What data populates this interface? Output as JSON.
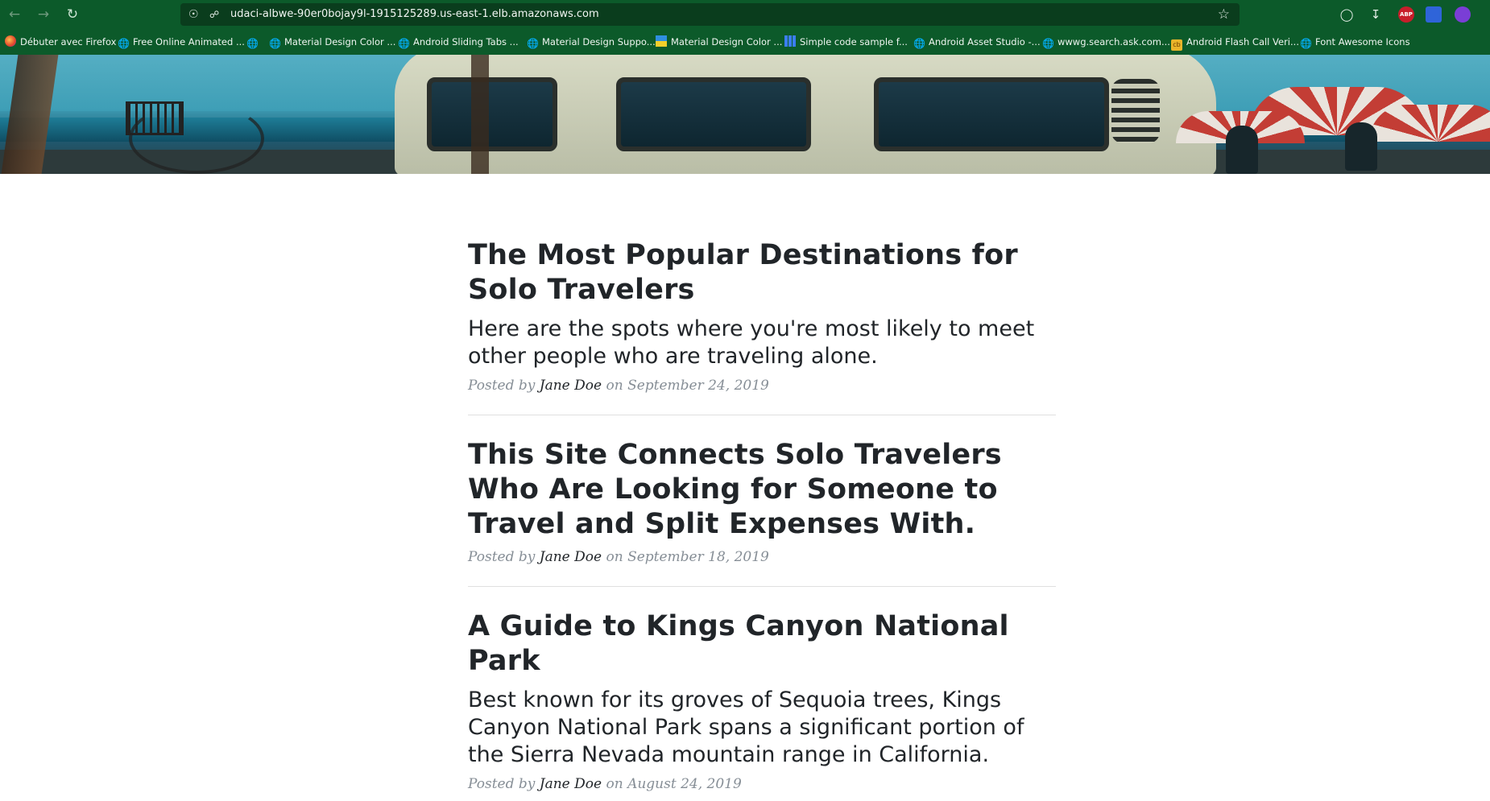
{
  "browser": {
    "url": "udaci-albwe-90er0bojay9l-1915125289.us-east-1.elb.amazonaws.com",
    "icons": {
      "back": "back-arrow-icon",
      "forward": "forward-arrow-icon",
      "reload": "reload-icon",
      "shield": "tracking-shield-icon",
      "lock": "lock-icon",
      "bookmark_star": "star-icon",
      "pocket": "pocket-icon",
      "downloads": "download-icon",
      "abp": "ABP",
      "extension_blue": "extension-icon",
      "extension_purple": "extension-icon"
    },
    "bookmarks": [
      {
        "label": "Débuter avec Firefox",
        "icon": "firefox-icon"
      },
      {
        "label": "Free Online Animated ...",
        "icon": "globe-icon"
      },
      {
        "label": "",
        "icon": "globe-icon"
      },
      {
        "label": "Material Design Color ...",
        "icon": "globe-icon"
      },
      {
        "label": "Android Sliding Tabs ...",
        "icon": "globe-icon"
      },
      {
        "label": "Material Design Suppo...",
        "icon": "globe-icon"
      },
      {
        "label": "Material Design Color ...",
        "icon": "material-icon"
      },
      {
        "label": "Simple code sample f...",
        "icon": "grid-icon"
      },
      {
        "label": "Android Asset Studio -...",
        "icon": "globe-icon"
      },
      {
        "label": "wwwg.search.ask.com...",
        "icon": "globe-icon"
      },
      {
        "label": "Android Flash Call Veri...",
        "icon": "flash-icon"
      },
      {
        "label": "Font Awesome Icons",
        "icon": "globe-icon"
      }
    ]
  },
  "posts": [
    {
      "title": "The Most Popular Destinations for Solo Travelers",
      "subtitle": "Here are the spots where you're most likely to meet other people who are traveling alone.",
      "posted_by": "Posted by",
      "author": "Jane Doe",
      "on": "on",
      "date": "September 24, 2019"
    },
    {
      "title": "This Site Connects Solo Travelers Who Are Looking for Someone to Travel and Split Expenses With.",
      "subtitle": "",
      "posted_by": "Posted by",
      "author": "Jane Doe",
      "on": "on",
      "date": "September 18, 2019"
    },
    {
      "title": "A Guide to Kings Canyon National Park",
      "subtitle": "Best known for its groves of Sequoia trees, Kings Canyon National Park spans a significant portion of the Sierra Nevada mountain range in California.",
      "posted_by": "Posted by",
      "author": "Jane Doe",
      "on": "on",
      "date": "August 24, 2019"
    }
  ]
}
